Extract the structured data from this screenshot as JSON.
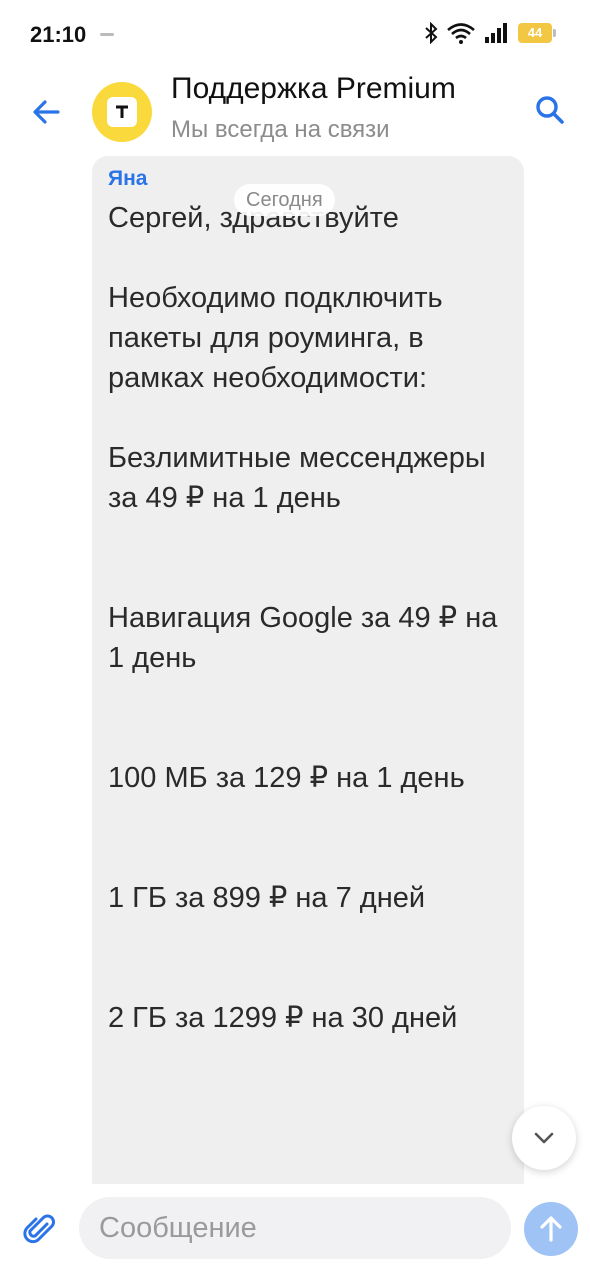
{
  "status_bar": {
    "time": "21:10",
    "battery_level": "44",
    "icons": [
      "bluetooth-icon",
      "wifi-icon",
      "signal-icon",
      "battery-icon"
    ]
  },
  "header": {
    "title": "Поддержка Premium",
    "subtitle": "Мы всегда на связи",
    "avatar_icon": "bank-logo-icon"
  },
  "date_separator": "Сегодня",
  "message": {
    "sender": "Яна",
    "greeting": "Сергей, здравствуйте",
    "intro": "Необходимо подключить пакеты для роуминга, в рамках необходимости:",
    "packages": [
      "Безлимитные мессенджеры за 49 ₽ на 1 день",
      "Навигация Google за 49 ₽ на 1 день",
      "100 МБ за 129 ₽ на 1 день",
      "1 ГБ за 899 ₽ на 7 дней",
      "2 ГБ за 1299 ₽ на 30 дней"
    ]
  },
  "composer": {
    "placeholder": "Сообщение",
    "value": ""
  },
  "colors": {
    "accent": "#2b74e8",
    "avatar_bg": "#f9d93b",
    "bubble_bg": "#efefef",
    "send_bg": "#9fc3f5",
    "battery": "#f2c744"
  }
}
